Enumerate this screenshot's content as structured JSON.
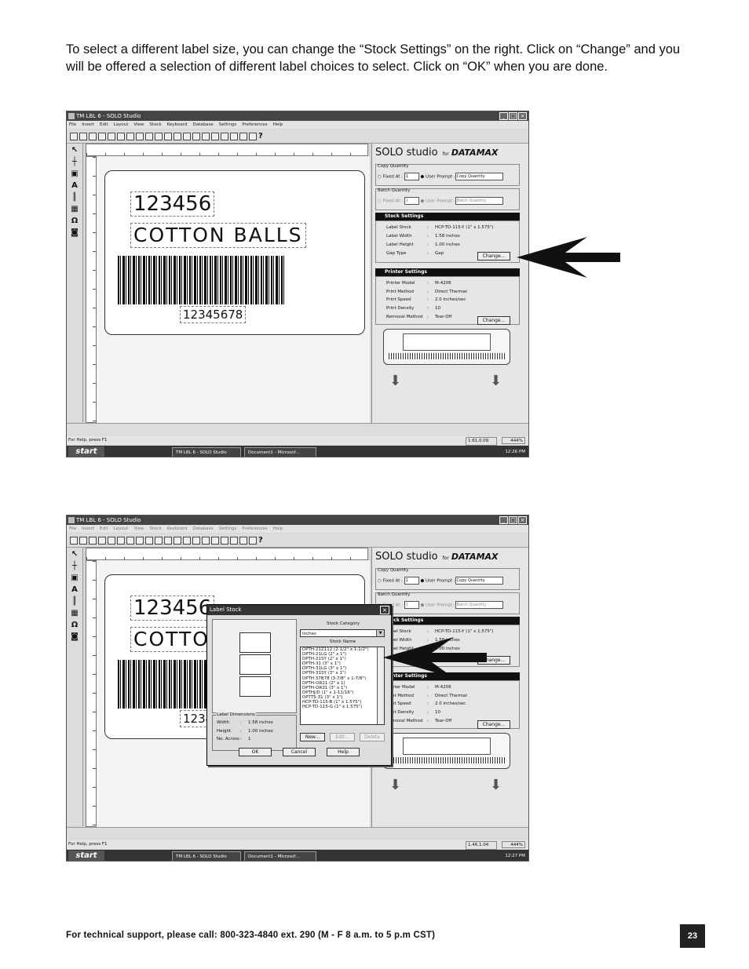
{
  "intro_text": "To select a different label size, you can change the “Stock Settings” on the right.  Click on “Change” and you will be offered a selection of different label choices to select.  Click on “OK” when you are done.",
  "app": {
    "title": "TM LBL 6 - SOLO Studio",
    "menu": [
      "File",
      "Insert",
      "Edit",
      "Layout",
      "View",
      "Stock",
      "Keyboard",
      "Database",
      "Settings",
      "Preferences",
      "Help"
    ],
    "logo_text": "SOLO studio",
    "logo_for": "for",
    "logo_brand": "DATAMAX",
    "label_fields": {
      "number": "123456",
      "name": "COTTON BALLS",
      "barcode_text": "12345678"
    },
    "copy_quantity": {
      "title": "Copy Quantity",
      "fixed": "Fixed At :",
      "fixed_val": "1",
      "user": "User Prompt :",
      "user_val": "Copy Quantity"
    },
    "batch_quantity": {
      "title": "Batch Quantity",
      "fixed": "Fixed At :",
      "fixed_val": "1",
      "user": "User Prompt :",
      "user_val": "Batch Quantity"
    },
    "stock_settings": {
      "title": "Stock Settings",
      "rows": [
        {
          "k": "Label Stock",
          "v": "HCP-TD-115-Y (1\" x 1.575\")"
        },
        {
          "k": "Label Width",
          "v": "1.58    inches"
        },
        {
          "k": "Label Height",
          "v": "1.00    inches"
        },
        {
          "k": "Gap Type",
          "v": "Gap"
        }
      ],
      "change": "Change..."
    },
    "printer_settings": {
      "title": "Printer Settings",
      "rows": [
        {
          "k": "Printer Model",
          "v": "M-4206"
        },
        {
          "k": "Print Method",
          "v": "Direct Thermal"
        },
        {
          "k": "Print Speed",
          "v": "2.0     inches/sec"
        },
        {
          "k": "Print Density",
          "v": "10"
        },
        {
          "k": "Removal Method",
          "v": "Tear-Off"
        }
      ],
      "change": "Change..."
    },
    "status_help": "For Help, press F1",
    "zoom": "444%",
    "start": "start",
    "task1": "TM LBL 6 - SOLO Studio",
    "task2": "Document1 - Microsof..."
  },
  "shot1": {
    "position": "1.61,0.09",
    "clock": "12:26 PM"
  },
  "shot2": {
    "position": "1.46,1.04",
    "clock": "12:27 PM"
  },
  "dialog": {
    "title": "Label Stock",
    "category_label": "Stock Category",
    "category_value": "Inches",
    "name_label": "Stock Name",
    "items": [
      "DPTH-21Z112 (2-1/2\" x 1-1/2\")",
      "DPTH-21LG (2\" x 1\")",
      "DPTH-21SY (2\" x 1\")",
      "DPTH-31 (3\" x 1\")",
      "DPTH-31LG (3\" x 1\")",
      "DPTH-31SY (3\" x 1\")",
      "DPTH 37B78 (3-7/8\" x 1-7/8\")",
      "DPTH-OR21 (2\" x 1)",
      "DPTH-OR31 (3\" x 1\")",
      "DPTHJ/D (1\" x 1-11/16\")",
      "DPTT5-31 (3\" x 1\")",
      "HCP-TD-115-B (1\" x 1.575\")",
      "HCP-TD-115-G (1\" x 1.575\")"
    ],
    "dims_legend": "Label Dimensions",
    "dims": [
      {
        "k": "Width",
        "v": "1.58  inches"
      },
      {
        "k": "Height",
        "v": "1.00  inches"
      },
      {
        "k": "No. Across",
        "v": "1"
      }
    ],
    "new": "New...",
    "edit": "Edit...",
    "delete": "Delete",
    "ok": "OK",
    "cancel": "Cancel",
    "help": "Help"
  },
  "footer": "For technical support, please call: 800-323-4840 ext. 290 (M - F  8 a.m. to 5 p.m CST)",
  "page_number": "23"
}
